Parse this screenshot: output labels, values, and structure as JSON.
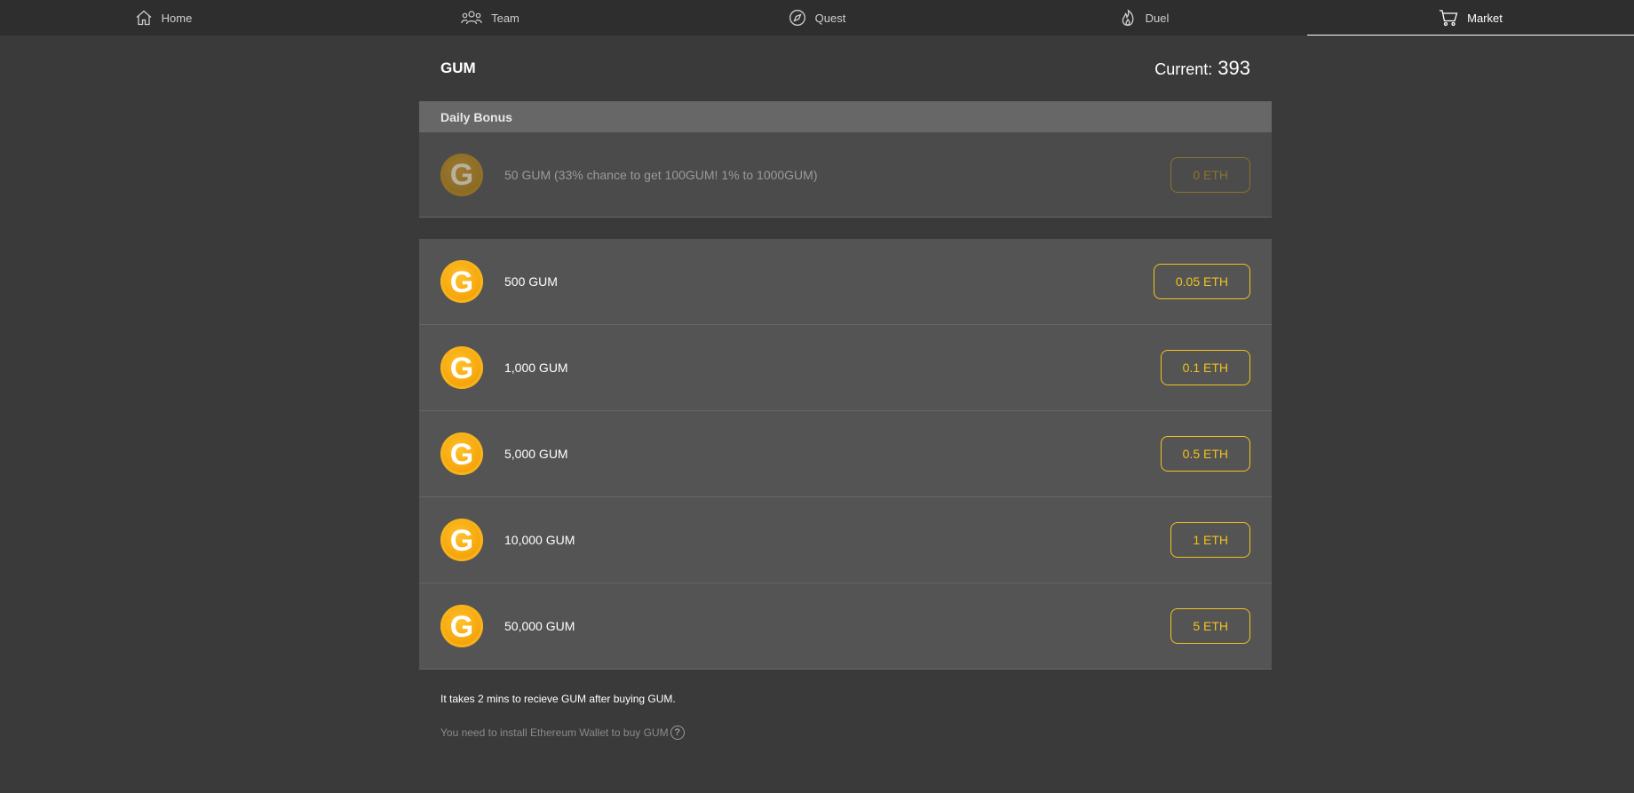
{
  "nav": {
    "items": [
      {
        "label": "Home",
        "icon": "home-icon"
      },
      {
        "label": "Team",
        "icon": "team-icon"
      },
      {
        "label": "Quest",
        "icon": "compass-icon"
      },
      {
        "label": "Duel",
        "icon": "flame-icon"
      },
      {
        "label": "Market",
        "icon": "cart-icon",
        "active": true
      }
    ]
  },
  "header": {
    "title": "GUM",
    "current_label": "Current:",
    "current_value": "393"
  },
  "daily_bonus": {
    "heading": "Daily Bonus",
    "coin_letter": "G",
    "label": "50 GUM (33% chance to get 100GUM! 1% to 1000GUM)",
    "price": "0 ETH"
  },
  "packages": [
    {
      "coin_letter": "G",
      "label": "500 GUM",
      "price": "0.05 ETH"
    },
    {
      "coin_letter": "G",
      "label": "1,000 GUM",
      "price": "0.1 ETH"
    },
    {
      "coin_letter": "G",
      "label": "5,000 GUM",
      "price": "0.5 ETH"
    },
    {
      "coin_letter": "G",
      "label": "10,000 GUM",
      "price": "1 ETH"
    },
    {
      "coin_letter": "G",
      "label": "50,000 GUM",
      "price": "5 ETH"
    }
  ],
  "notes": {
    "delivery": "It takes 2 mins to recieve GUM after buying GUM.",
    "wallet": "You need to install Ethereum Wallet to buy GUM",
    "help_glyph": "?"
  },
  "colors": {
    "accent": "#f2c21f",
    "coin": "#f6a60c",
    "background": "#3a3a3a",
    "nav_background": "#2e2e2e"
  }
}
